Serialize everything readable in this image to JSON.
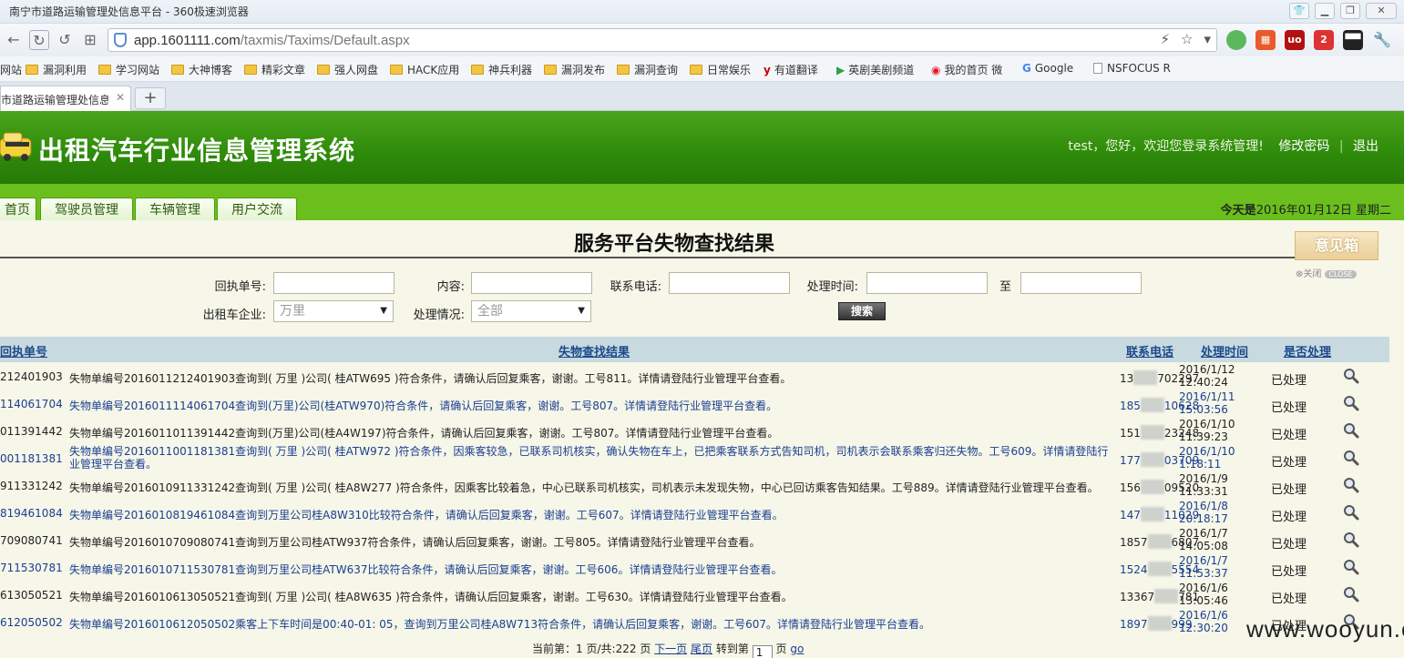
{
  "browser": {
    "window_title": "南宁市道路运输管理处信息平台 - 360极速浏览器",
    "url_host": "app.1601111.com",
    "url_path": "/taxmis/Taxims/Default.aspx",
    "bookmarks": [
      "网站",
      "漏洞利用",
      "学习网站",
      "大神博客",
      "精彩文章",
      "强人网盘",
      "HACK应用",
      "神兵利器",
      "漏洞发布",
      "漏洞查询",
      "日常娱乐",
      "有道翻译",
      "英剧美剧频道",
      "我的首页 微",
      "Google",
      "NSFOCUS R"
    ],
    "tab_title": "市道路运输管理处信息",
    "ext_badge": "2"
  },
  "app": {
    "title": "出租汽车行业信息管理系统",
    "greeting": "test，您好，欢迎您登录系统管理!",
    "change_password": "修改密码",
    "logout": "退出",
    "nav": [
      "首页",
      "驾驶员管理",
      "车辆管理",
      "用户交流"
    ],
    "today_label": "今天是",
    "today_value": "2016年01月12日 星期二"
  },
  "page": {
    "title": "服务平台失物查找结果",
    "feedback": "意见箱",
    "feedback_close": "关闭",
    "feedback_close_en": "CLOSE"
  },
  "form": {
    "receipt_label": "回执单号:",
    "content_label": "内容:",
    "phone_label": "联系电话:",
    "time_label": "处理时间:",
    "to_label": "至",
    "company_label": "出租车企业:",
    "company_value": "万里",
    "status_label": "处理情况:",
    "status_value": "全部",
    "search_button": "搜索"
  },
  "table": {
    "headers": [
      "回执单号",
      "失物查找结果",
      "联系电话",
      "处理时间",
      "是否处理"
    ],
    "rows": [
      {
        "id": "212401903",
        "result": "失物单编号2016011212401903查询到( 万里 )公司( 桂ATW695 )符合条件，请确认后回复乘客，谢谢。工号811。详情请登陆行业管理平台查看。",
        "phone_a": "13",
        "phone_b": "702297",
        "date": "2016/1/12",
        "time": "12:40:24",
        "status": "已处理",
        "blue": false,
        "wrap": false
      },
      {
        "id": "114061704",
        "result": "失物单编号2016011114061704查询到(万里)公司(桂ATW970)符合条件，请确认后回复乘客，谢谢。工号807。详情请登陆行业管理平台查看。",
        "phone_a": "185",
        "phone_b": "10628",
        "date": "2016/1/11",
        "time": "15:03:56",
        "status": "已处理",
        "blue": true,
        "wrap": false
      },
      {
        "id": "011391442",
        "result": "失物单编号2016011011391442查询到(万里)公司(桂A4W197)符合条件，请确认后回复乘客，谢谢。工号807。详情请登陆行业管理平台查看。",
        "phone_a": "151",
        "phone_b": "23248",
        "date": "2016/1/10",
        "time": "11:39:23",
        "status": "已处理",
        "blue": false,
        "wrap": false
      },
      {
        "id": "001181381",
        "result": "失物单编号2016011001181381查询到( 万里 )公司( 桂ATW972 )符合条件，因乘客较急，已联系司机核实，确认失物在车上，已把乘客联系方式告知司机，司机表示会联系乘客归还失物。工号609。详情请登陆行业管理平台查看。",
        "phone_a": "177",
        "phone_b": "03709",
        "date": "2016/1/10",
        "time": "1:18:11",
        "status": "已处理",
        "blue": true,
        "wrap": true
      },
      {
        "id": "911331242",
        "result": "失物单编号2016010911331242查询到( 万里 )公司( 桂A8W277 )符合条件，因乘客比较着急，中心已联系司机核实，司机表示未发现失物，中心已回访乘客告知结果。工号889。详情请登陆行业管理平台查看。",
        "phone_a": "156",
        "phone_b": "09520",
        "date": "2016/1/9",
        "time": "11:33:31",
        "status": "已处理",
        "blue": false,
        "wrap": false
      },
      {
        "id": "819461084",
        "result": "失物单编号2016010819461084查询到万里公司桂A8W310比较符合条件，请确认后回复乘客，谢谢。工号607。详情请登陆行业管理平台查看。",
        "phone_a": "147",
        "phone_b": "11029",
        "date": "2016/1/8",
        "time": "20:18:17",
        "status": "已处理",
        "blue": true,
        "wrap": false
      },
      {
        "id": "709080741",
        "result": "失物单编号2016010709080741查询到万里公司桂ATW937符合条件，请确认后回复乘客，谢谢。工号805。详情请登陆行业管理平台查看。",
        "phone_a": "1857",
        "phone_b": "6807",
        "date": "2016/1/7",
        "time": "14:05:08",
        "status": "已处理",
        "blue": false,
        "wrap": false
      },
      {
        "id": "711530781",
        "result": "失物单编号2016010711530781查询到万里公司桂ATW637比较符合条件，请确认后回复乘客，谢谢。工号606。详情请登陆行业管理平台查看。",
        "phone_a": "1524",
        "phone_b": "5554",
        "date": "2016/1/7",
        "time": "11:53:37",
        "status": "已处理",
        "blue": true,
        "wrap": false
      },
      {
        "id": "613050521",
        "result": "失物单编号2016010613050521查询到( 万里 )公司( 桂A8W635 )符合条件，请确认后回复乘客，谢谢。工号630。详情请登陆行业管理平台查看。",
        "phone_a": "13367",
        "phone_b": "781",
        "date": "2016/1/6",
        "time": "13:05:46",
        "status": "已处理",
        "blue": false,
        "wrap": false
      },
      {
        "id": "612050502",
        "result": "失物单编号2016010612050502乘客上下车时间是00:40-01: 05，查询到万里公司桂A8W713符合条件，请确认后回复乘客，谢谢。工号607。详情请登陆行业管理平台查看。",
        "phone_a": "1897",
        "phone_b": "999",
        "date": "2016/1/6",
        "time": "12:30:20",
        "status": "已处理",
        "blue": true,
        "wrap": false
      }
    ]
  },
  "pager": {
    "current_label": "当前第：",
    "current": "1",
    "total_label": "页/共:",
    "total": "222",
    "page_unit": "页",
    "next": "下一页",
    "last": "尾页",
    "goto_label": "转到第",
    "goto_value": "1",
    "go": "go"
  },
  "watermark": "www.wooyun.org"
}
